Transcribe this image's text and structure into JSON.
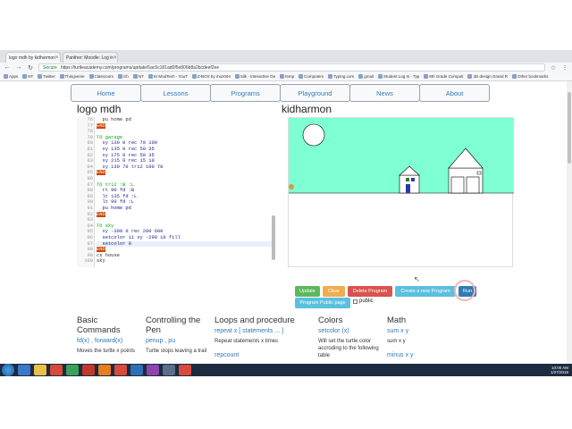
{
  "browser": {
    "tabs": [
      {
        "label": "logo mdh by kidharmon"
      },
      {
        "label": "Panther: Moodle: Log in"
      }
    ],
    "address": {
      "secure_label": "Secure",
      "url": "https://turtleacademy.com/programs/update/5ac5c181ad0f5e806b8a2bcdeef2ee"
    },
    "bookmarks": [
      "Apps",
      "NT",
      "Twitter",
      "Thingvenie",
      "Classroom",
      "ich",
      "NT",
      "KI ModTech - YouT",
      "Z-BOX by muz004",
      "Silk - Interactive Ge",
      "temp",
      "Computers",
      "Typing.com",
      "gmail",
      "Student Log In - Typ",
      "6th Grade Computi",
      "3D design Grand R",
      "Other bookmarks"
    ]
  },
  "nav": {
    "items": [
      "Home",
      "Lessons",
      "Programs",
      "Playground",
      "News",
      "About"
    ]
  },
  "program": {
    "title": "logo mdh",
    "author": "kidharmon"
  },
  "editor": {
    "lines": [
      {
        "num": "76",
        "text": "  pu home pd",
        "type": "plain"
      },
      {
        "num": "77",
        "text": "END",
        "type": "end"
      },
      {
        "num": "78",
        "text": "",
        "type": "plain"
      },
      {
        "num": "79",
        "text": "TO garage",
        "type": "kw"
      },
      {
        "num": "80",
        "text": "  xy 130 0 rec 70 100",
        "type": "code"
      },
      {
        "num": "81",
        "text": "  xy 135 0 rec 50 35",
        "type": "code"
      },
      {
        "num": "82",
        "text": "  xy 175 0 rec 50 35",
        "type": "code"
      },
      {
        "num": "83",
        "text": "  xy 215 0 rec 15 10",
        "type": "code"
      },
      {
        "num": "84",
        "text": "  xy 130 70 tri2 100 70",
        "type": "code"
      },
      {
        "num": "85",
        "text": "END",
        "type": "end"
      },
      {
        "num": "86",
        "text": "",
        "type": "plain"
      },
      {
        "num": "87",
        "text": "TO tri2 :B :L",
        "type": "kw"
      },
      {
        "num": "88",
        "text": "  rt 90 fd :B",
        "type": "code"
      },
      {
        "num": "89",
        "text": "  lt 135 fd :L",
        "type": "code"
      },
      {
        "num": "90",
        "text": "  lt 90 fd :L",
        "type": "code"
      },
      {
        "num": "91",
        "text": "  pu home pd",
        "type": "code"
      },
      {
        "num": "92",
        "text": "END",
        "type": "end"
      },
      {
        "num": "93",
        "text": "",
        "type": "plain"
      },
      {
        "num": "94",
        "text": "TO sky",
        "type": "kw"
      },
      {
        "num": "95",
        "text": "  xy -300 0 rec 200 600",
        "type": "code"
      },
      {
        "num": "96",
        "text": "  setcolor 11 xy -298 10 fill",
        "type": "code"
      },
      {
        "num": "97",
        "text": "  setcolor 0",
        "type": "sel"
      },
      {
        "num": "98",
        "text": "END",
        "type": "end"
      },
      {
        "num": "99",
        "text": "cs house",
        "type": "plain"
      },
      {
        "num": "100",
        "text": "sky",
        "type": "plain"
      }
    ]
  },
  "canvas": {
    "sky_color": "#7fffd4",
    "ground_color": "#ffffff"
  },
  "buttons": {
    "update": "Update",
    "clear": "Clear",
    "delete": "Delete Program",
    "create": "Create a new Program",
    "run": "Run",
    "public_page": "Program Public page",
    "public_checkbox": "public"
  },
  "colors": {
    "update": "#5cb85c",
    "clear": "#f0ad4e",
    "delete": "#d9534f",
    "create": "#5bc0de",
    "run": "#337ab7",
    "link": "#337ab7"
  },
  "reference": [
    {
      "heading": "Basic Commands",
      "cmd": "fd(x) , forward(x)",
      "desc": "Moves the turtle x points"
    },
    {
      "heading": "Controlling the Pen",
      "cmd": "penup , pu",
      "desc": "Turtle stops leaving a trail"
    },
    {
      "heading": "Loops and procedure",
      "cmd": "repeat x [ statements ... ]",
      "desc": "Repeat statements x times",
      "cmd2": "repcount"
    },
    {
      "heading": "Colors",
      "cmd": "setcolor (x)",
      "desc": "Will set the turtle color accroding to the following table"
    },
    {
      "heading": "Math",
      "cmd": "sum x y",
      "desc": "sum x y",
      "cmd2": "minus x y"
    }
  ],
  "taskbar": {
    "time": "10:00 AM",
    "date": "1/27/2018"
  }
}
